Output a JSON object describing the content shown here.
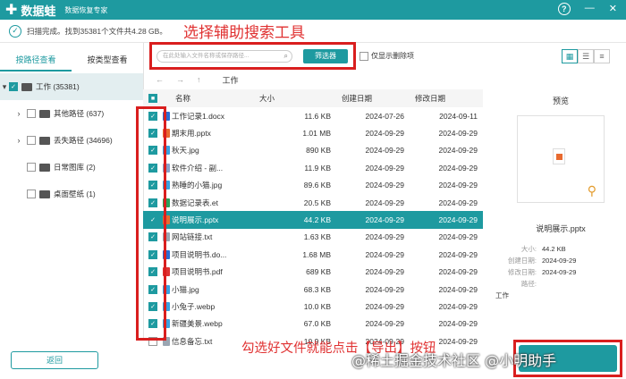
{
  "app": {
    "logo_text": "数据蛙",
    "subtitle": "数据恢复专家"
  },
  "window": {
    "help": "?",
    "minimize": "—",
    "close": "✕"
  },
  "status": {
    "text": "扫描完成。找到35381个文件共4.28 GB。"
  },
  "annotations": {
    "top": "选择辅助搜索工具",
    "bottom": "勾选好文件就能点击【导出】按钮",
    "watermark": "@稀土掘金技术社区 @小明助手"
  },
  "tabs": {
    "by_path": "按路径查看",
    "by_type": "按类型查看"
  },
  "tree": [
    {
      "label": "工作 (35381)",
      "selected": true,
      "checked": true
    },
    {
      "label": "其他路径 (637)"
    },
    {
      "label": "丢失路径 (34696)"
    },
    {
      "label": "日常图库 (2)"
    },
    {
      "label": "桌面壁纸 (1)"
    }
  ],
  "search": {
    "placeholder": "在此处输入文件名称或保存路径...",
    "filter_button": "筛选器",
    "only_deleted": "仅显示删除项"
  },
  "nav": {
    "back": "←",
    "forward": "→",
    "up": "↑",
    "path": "工作"
  },
  "table": {
    "headers": [
      "名称",
      "大小",
      "创建日期",
      "修改日期"
    ],
    "rows": [
      {
        "name": "工作记录1.docx",
        "size": "11.6 KB",
        "created": "2024-07-26",
        "modified": "2024-09-11",
        "icon": "docx",
        "checked": true
      },
      {
        "name": "期末用.pptx",
        "size": "1.01 MB",
        "created": "2024-09-29",
        "modified": "2024-09-29",
        "icon": "pptx",
        "checked": true
      },
      {
        "name": "秋天.jpg",
        "size": "890 KB",
        "created": "2024-09-29",
        "modified": "2024-09-29",
        "icon": "jpg",
        "checked": true
      },
      {
        "name": "软件介绍 - 副...",
        "size": "11.9 KB",
        "created": "2024-09-29",
        "modified": "2024-09-29",
        "icon": "doc",
        "checked": true
      },
      {
        "name": "熟睡的小猫.jpg",
        "size": "89.6 KB",
        "created": "2024-09-29",
        "modified": "2024-09-29",
        "icon": "jpg",
        "checked": true
      },
      {
        "name": "数据记录表.et",
        "size": "20.5 KB",
        "created": "2024-09-29",
        "modified": "2024-09-29",
        "icon": "et",
        "checked": true
      },
      {
        "name": "说明展示.pptx",
        "size": "44.2 KB",
        "created": "2024-09-29",
        "modified": "2024-09-29",
        "icon": "pptx",
        "checked": true,
        "highlight": true
      },
      {
        "name": "网站链接.txt",
        "size": "1.63 KB",
        "created": "2024-09-29",
        "modified": "2024-09-29",
        "icon": "txt",
        "checked": true
      },
      {
        "name": "项目说明书.do...",
        "size": "1.68 MB",
        "created": "2024-09-29",
        "modified": "2024-09-29",
        "icon": "docx",
        "checked": true
      },
      {
        "name": "项目说明书.pdf",
        "size": "689 KB",
        "created": "2024-09-29",
        "modified": "2024-09-29",
        "icon": "pdf",
        "checked": true
      },
      {
        "name": "小猫.jpg",
        "size": "68.3 KB",
        "created": "2024-09-29",
        "modified": "2024-09-29",
        "icon": "jpg",
        "checked": true
      },
      {
        "name": "小兔子.webp",
        "size": "10.0 KB",
        "created": "2024-09-29",
        "modified": "2024-09-29",
        "icon": "webp",
        "checked": true
      },
      {
        "name": "新疆美景.webp",
        "size": "67.0 KB",
        "created": "2024-09-29",
        "modified": "2024-09-29",
        "icon": "webp",
        "checked": true
      },
      {
        "name": "信息备忘.txt",
        "size": "10.9 KB",
        "created": "2024-09-29",
        "modified": "2024-09-29",
        "icon": "txt",
        "checked": false
      }
    ]
  },
  "preview": {
    "title": "预览",
    "file_name": "说明展示.pptx",
    "size_label": "大小:",
    "size": "44.2 KB",
    "created_label": "创建日期:",
    "created": "2024-09-29",
    "modified_label": "修改日期:",
    "modified": "2024-09-29",
    "path_label": "路径:",
    "path": "工作"
  },
  "buttons": {
    "back": "返回"
  },
  "colors": {
    "accent": "#1e9aa0",
    "annotation": "#d91e1e"
  }
}
